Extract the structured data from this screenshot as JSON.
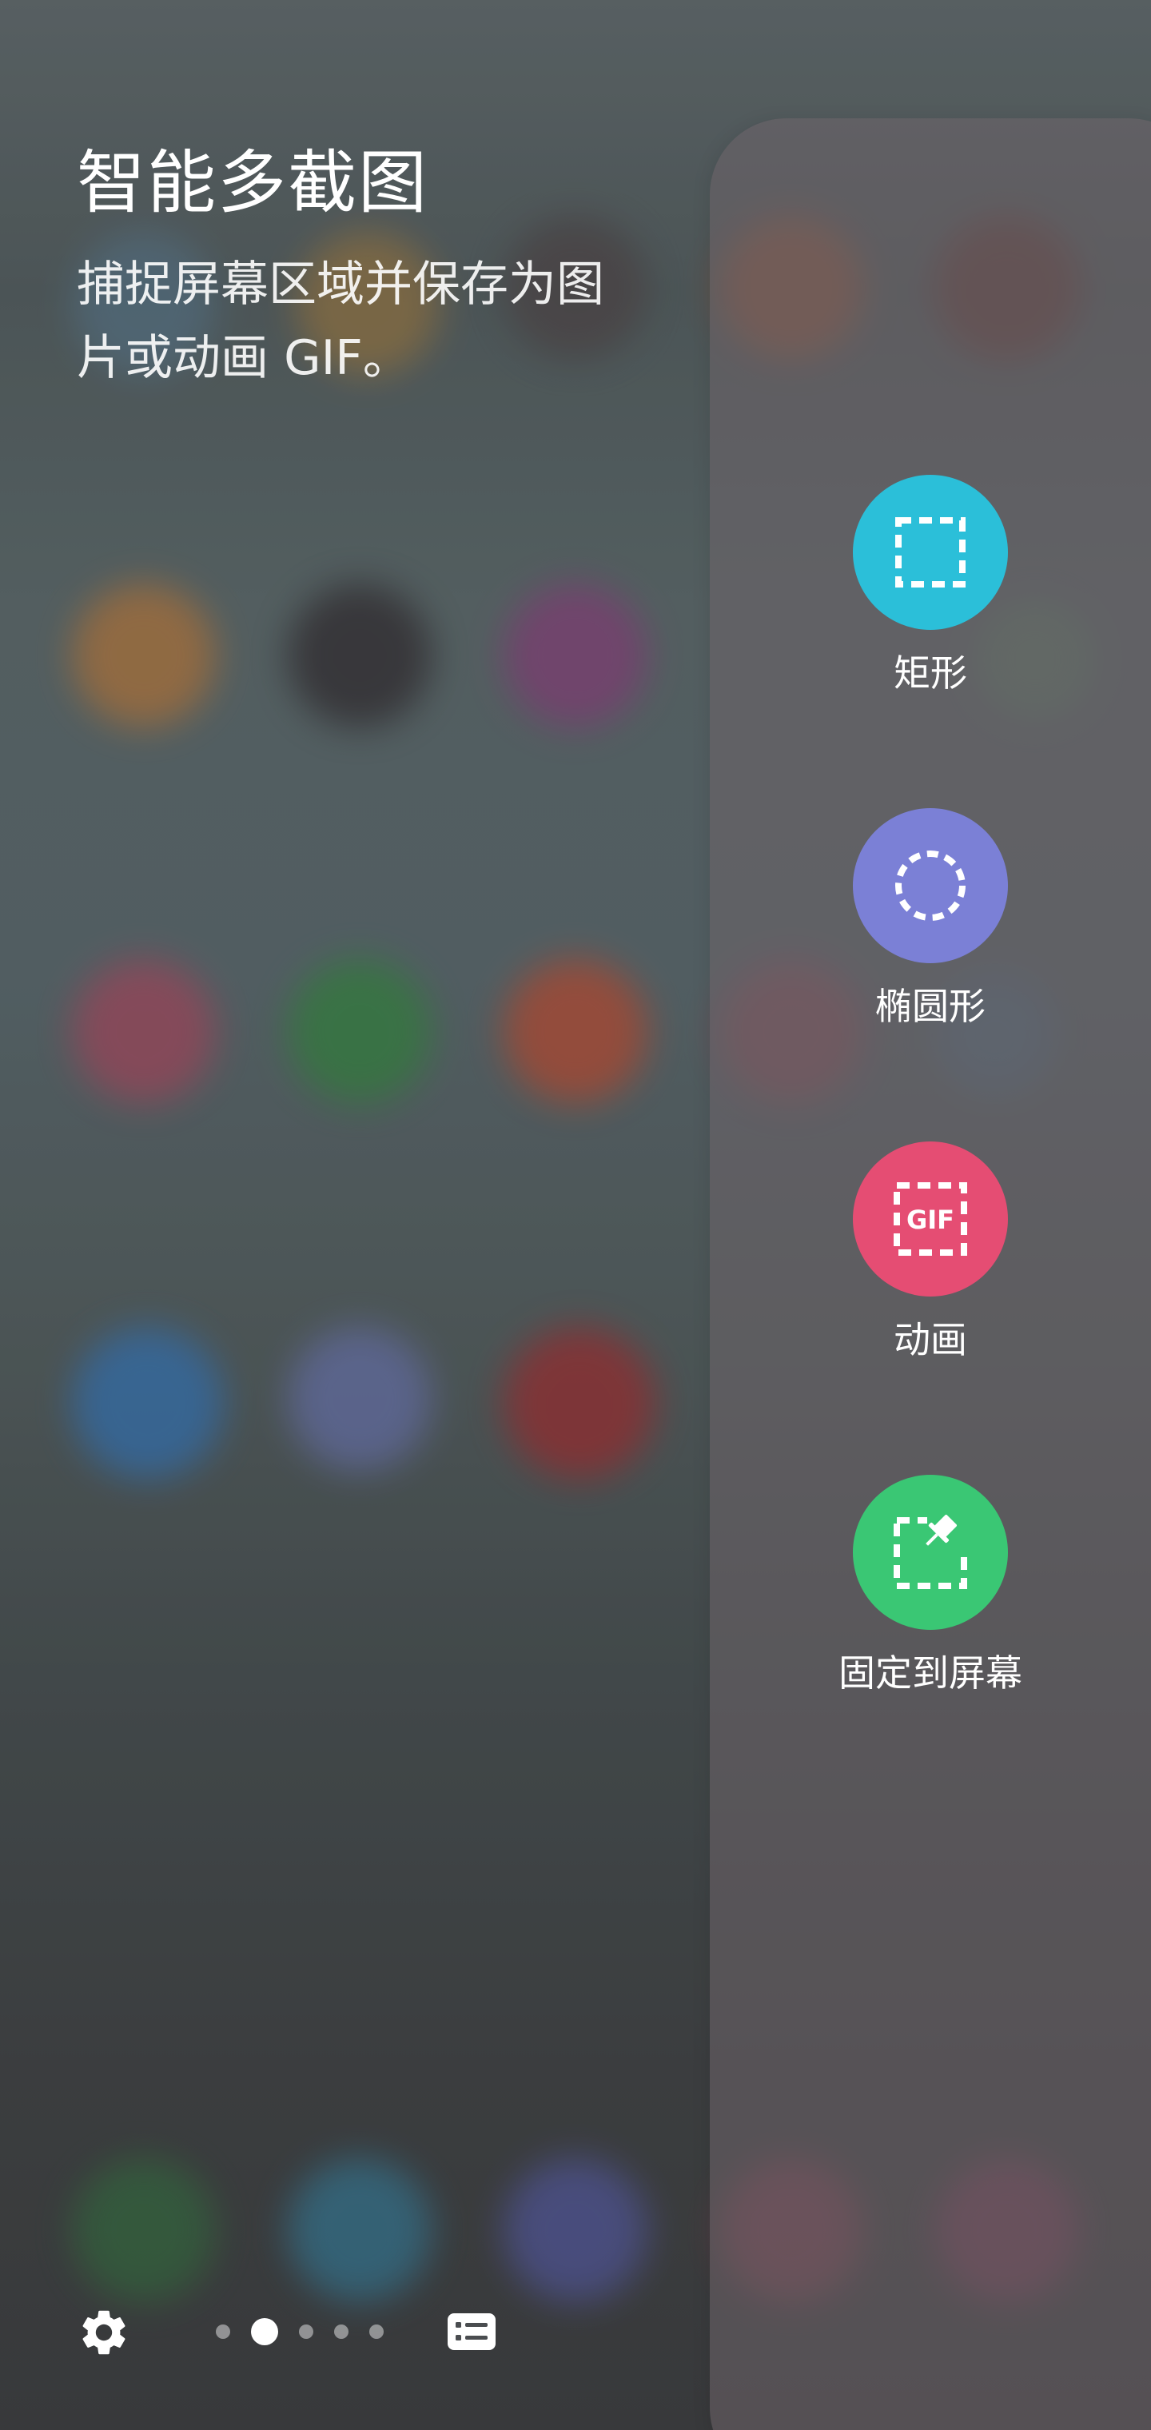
{
  "panel": {
    "title": "智能多截图",
    "description": "捕捉屏幕区域并保存为图片或动画 GIF。"
  },
  "tools": [
    {
      "label": "矩形",
      "icon": "rectangle-select-icon",
      "color": "#2bbfd9"
    },
    {
      "label": "椭圆形",
      "icon": "oval-select-icon",
      "color": "#7b80d6"
    },
    {
      "label": "动画",
      "icon": "gif-icon",
      "color": "#e54d73"
    },
    {
      "label": "固定到屏幕",
      "icon": "pin-to-screen-icon",
      "color": "#3ac774"
    }
  ],
  "bottom_bar": {
    "settings_icon": "gear-icon",
    "page_count": 5,
    "active_page": 2,
    "list_icon": "panel-list-icon"
  }
}
